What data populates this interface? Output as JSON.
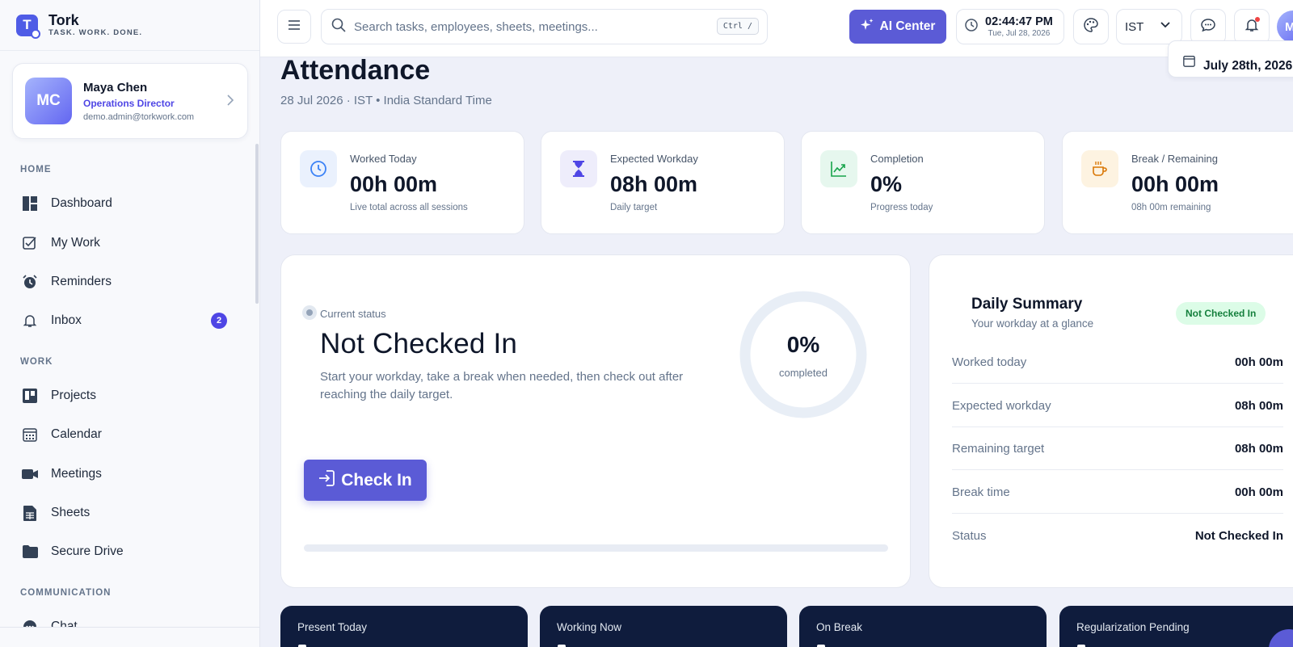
{
  "brand": {
    "name": "Tork",
    "tagline": "TASK. WORK. DONE.",
    "logo_letter": "T"
  },
  "profile": {
    "initials": "MC",
    "name": "Maya Chen",
    "role": "Operations Director",
    "email": "demo.admin@torkwork.com"
  },
  "sidebar": {
    "sections": [
      {
        "label": "HOME"
      },
      {
        "label": "WORK"
      },
      {
        "label": "COMMUNICATION"
      }
    ],
    "items": [
      {
        "label": "Dashboard",
        "icon": "dashboard-icon"
      },
      {
        "label": "My Work",
        "icon": "checkbox-icon"
      },
      {
        "label": "Reminders",
        "icon": "alarm-icon"
      },
      {
        "label": "Inbox",
        "icon": "bell-icon",
        "badge": "2"
      },
      {
        "label": "Projects",
        "icon": "kanban-icon"
      },
      {
        "label": "Calendar",
        "icon": "calendar-icon"
      },
      {
        "label": "Meetings",
        "icon": "video-icon"
      },
      {
        "label": "Sheets",
        "icon": "sheet-icon"
      },
      {
        "label": "Secure Drive",
        "icon": "folder-icon"
      },
      {
        "label": "Chat",
        "icon": "chat-icon"
      }
    ]
  },
  "topbar": {
    "search_placeholder": "Search tasks, employees, sheets, meetings...",
    "search_shortcut": "Ctrl /",
    "ai_label": "AI Center",
    "time": "02:44:47 PM",
    "date": "Tue, Jul 28, 2026",
    "timezone": "IST",
    "avatar_initial": "M"
  },
  "page": {
    "title": "Attendance",
    "subtitle": "28 Jul 2026 · IST • India Standard Time",
    "date_chip": "July 28th, 2026"
  },
  "stats": [
    {
      "label": "Worked Today",
      "value": "00h 00m",
      "note": "Live total across all sessions",
      "icon": "clock-icon",
      "color": "#3b82f6",
      "bg": "#eaf1fd"
    },
    {
      "label": "Expected Workday",
      "value": "08h 00m",
      "note": "Daily target",
      "icon": "hourglass-icon",
      "color": "#4f46e5",
      "bg": "#eeedfb"
    },
    {
      "label": "Completion",
      "value": "0%",
      "note": "Progress today",
      "icon": "trend-icon",
      "color": "#16a34a",
      "bg": "#e6f7ee"
    },
    {
      "label": "Break / Remaining",
      "value": "00h 00m",
      "note": "08h 00m remaining",
      "icon": "coffee-icon",
      "color": "#d97706",
      "bg": "#fdf3e1"
    }
  ],
  "status": {
    "label": "Current status",
    "value": "Not Checked In",
    "description": "Start your workday, take a break when needed, then check out after reaching the daily target.",
    "percent": "0%",
    "percent_label": "completed",
    "progress": 0,
    "button": "Check In"
  },
  "summary": {
    "title": "Daily Summary",
    "subtitle": "Your workday at a glance",
    "badge": "Not Checked In",
    "rows": [
      {
        "key": "Worked today",
        "value": "00h 00m"
      },
      {
        "key": "Expected workday",
        "value": "08h 00m"
      },
      {
        "key": "Remaining target",
        "value": "08h 00m"
      },
      {
        "key": "Break time",
        "value": "00h 00m"
      },
      {
        "key": "Status",
        "value": "Not Checked In"
      }
    ]
  },
  "team_cards": [
    {
      "label": "Present Today"
    },
    {
      "label": "Working Now"
    },
    {
      "label": "On Break"
    },
    {
      "label": "Regularization Pending"
    }
  ]
}
